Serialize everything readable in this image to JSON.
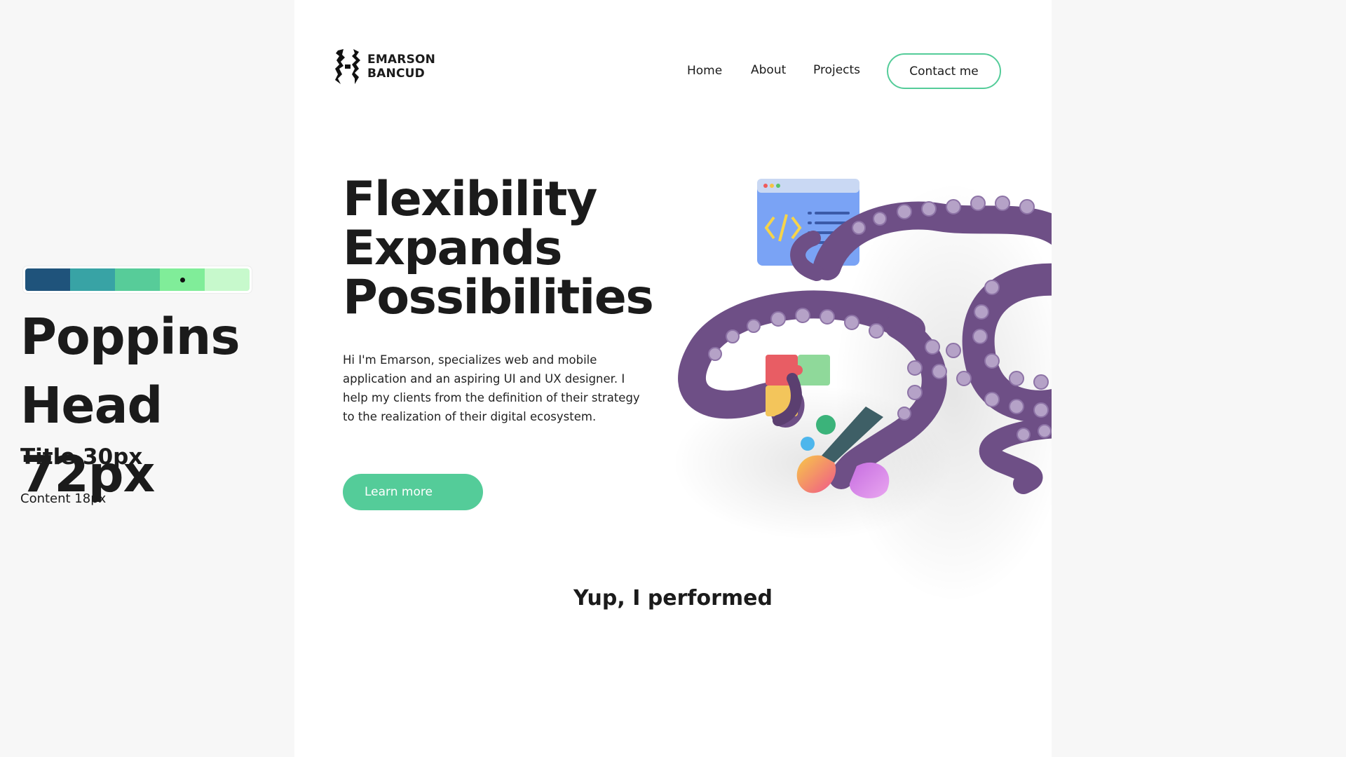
{
  "style_guide": {
    "palette": [
      "#1f537b",
      "#38a3a5",
      "#57cc99",
      "#80ed99",
      "#c7f9cc"
    ],
    "selected_swatch": 3,
    "head_sample": "Poppins Head 72px",
    "title_sample": "Title 30px",
    "content_sample": "Content 18px"
  },
  "site": {
    "logo": {
      "line1": "EMARSON",
      "line2": "BANCUD"
    },
    "nav": {
      "home": "Home",
      "about": "About",
      "projects": "Projects",
      "contact": "Contact me"
    },
    "hero": {
      "title": "Flexibility Expands Possibilities",
      "text": "Hi I'm Emarson, specializes web and mobile application and an aspiring UI and UX designer. I help my clients from the definition of their strategy to the realization of their digital ecosystem.",
      "cta": "Learn more"
    },
    "section_title": "Yup, I performed",
    "colors": {
      "accent": "#54cc99",
      "text": "#1b1b1b",
      "octopus": "#6e4f86",
      "sucker": "#b5a2c7"
    }
  }
}
